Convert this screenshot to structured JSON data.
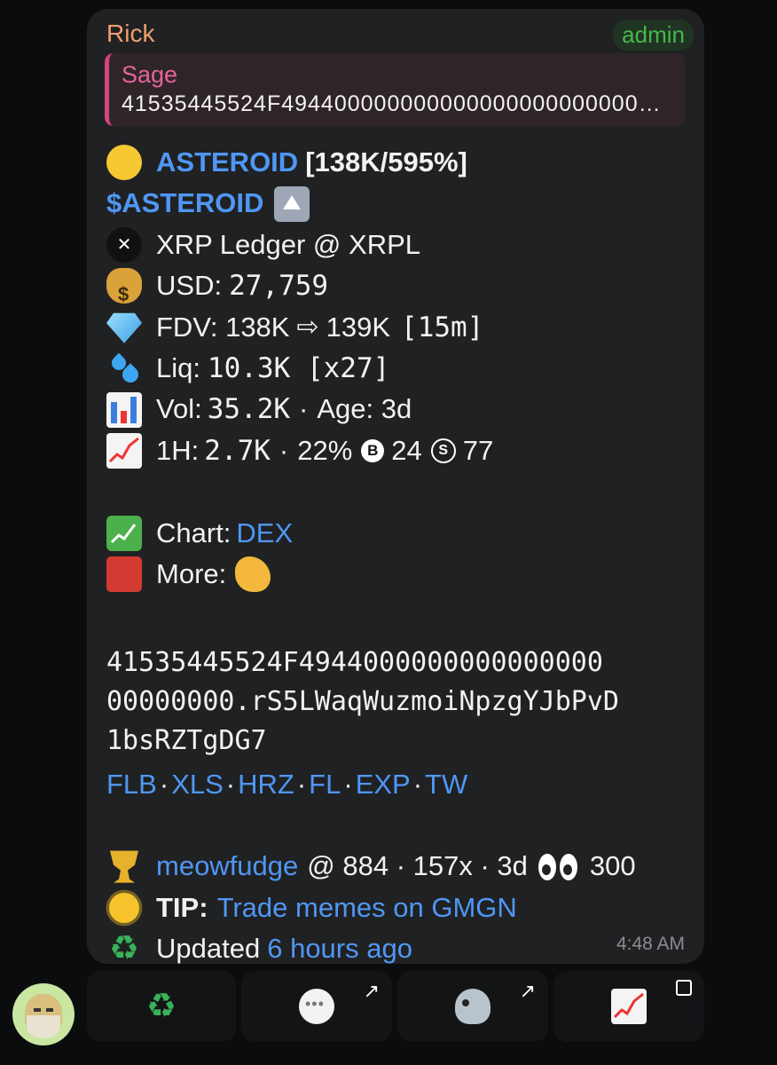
{
  "message": {
    "sender": "Rick",
    "role_badge": "admin",
    "reply": {
      "name": "Sage",
      "text": "41535445524F49440000000000000000000000000..."
    },
    "token_name": "ASTEROID",
    "mcap_change": "[138K/595%]",
    "ticker": "$ASTEROID",
    "chain_line": "XRP Ledger @ XRPL",
    "usd_label": "USD: ",
    "usd_value": "27,759",
    "fdv_label": "FDV: 138K",
    "fdv_arrow": "⇨",
    "fdv_to": "139K",
    "fdv_interval": "[15m]",
    "liq_label": "Liq: ",
    "liq_value": "10.3K [x27]",
    "vol_label": "Vol: ",
    "vol_value": "35.2K",
    "age": "Age: 3d",
    "h1_label": "1H: ",
    "h1_value": "2.7K",
    "h1_pct": "22%",
    "buy_icon": "B",
    "buys": "24",
    "sell_icon": "S",
    "sells": "77",
    "chart_label": "Chart: ",
    "chart_link": "DEX",
    "more_label": "More: ",
    "address_lines": [
      "41535445524F4944000000000000000",
      "00000000.rS5LWaqWuzmoiNpzgYJbPvD",
      "1bsRZTgDG7"
    ],
    "quick_links": [
      "FLB",
      "XLS",
      "HRZ",
      "FL",
      "EXP",
      "TW"
    ],
    "top_holder": "meowfudge",
    "holder_stats": "@ 884 · 157x · 3d",
    "watchers": "300",
    "tip_label": "TIP:",
    "tip_link": "Trade memes on GMGN",
    "updated_label": "Updated ",
    "updated_link": "6 hours ago",
    "time": "4:48 AM"
  },
  "buttons": [
    {
      "icon": "recycle-icon"
    },
    {
      "icon": "speech-bubble-icon"
    },
    {
      "icon": "bird-icon"
    },
    {
      "icon": "chart-increasing-icon"
    }
  ],
  "colors": {
    "link": "#4f97f5",
    "sender": "#f0a070",
    "admin": "#46b84a",
    "reply_accent": "#d4457f",
    "bubble": "#202122",
    "background": "#0b0c0d"
  }
}
